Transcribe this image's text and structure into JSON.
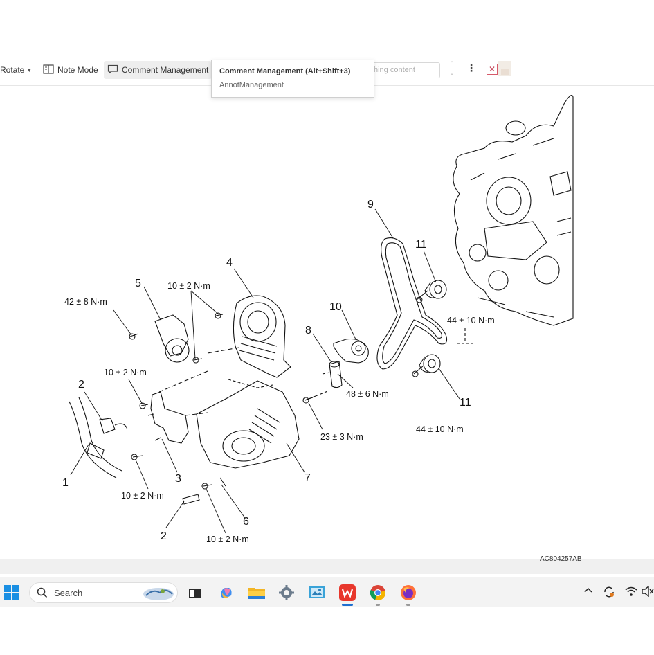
{
  "toolbar": {
    "rotate_label": "Rotate",
    "note_mode_label": "Note Mode",
    "comment_management_label": "Comment Management",
    "search_placeholder": "hing content"
  },
  "tooltip": {
    "title": "Comment Management (Alt+Shift+3)",
    "subtitle": "AnnotManagement"
  },
  "diagram": {
    "part_numbers": {
      "n1": "1",
      "n2a": "2",
      "n2b": "2",
      "n3": "3",
      "n4": "4",
      "n5": "5",
      "n6": "6",
      "n7": "7",
      "n8": "8",
      "n9": "9",
      "n10": "10",
      "n11a": "11",
      "n11b": "11"
    },
    "torques": {
      "t42": "42 ± 8 N·m",
      "t10_top": "10 ± 2 N·m",
      "t10_mid": "10 ± 2 N·m",
      "t10_low": "10 ± 2 N·m",
      "t10_bottom": "10 ± 2 N·m",
      "t48": "48 ± 6 N·m",
      "t23": "23 ± 3 N·m",
      "t44_upper": "44 ± 10 N·m",
      "t44_lower": "44 ± 10 N·m"
    },
    "reference_code": "AC804257AB"
  },
  "taskbar": {
    "search_label": "Search",
    "icons": [
      "windows-start-icon",
      "file-explorer-icon",
      "copilot-icon",
      "folder-icon",
      "settings-icon",
      "photos-icon",
      "wps-office-icon",
      "chrome-icon",
      "firefox-icon"
    ]
  },
  "tray": {
    "icons": [
      "chevron-up-icon",
      "sync-icon",
      "wifi-icon",
      "volume-mute-icon"
    ]
  }
}
